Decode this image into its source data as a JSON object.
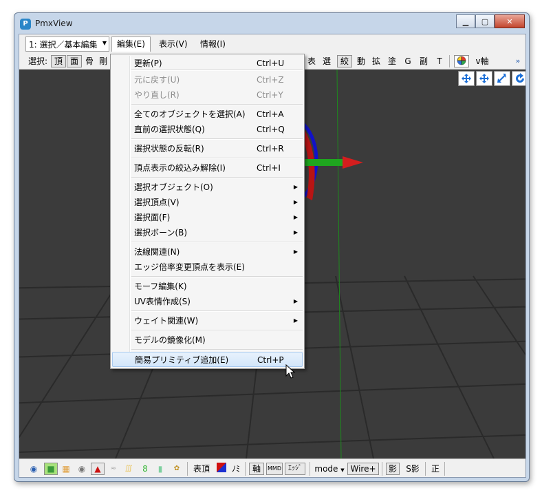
{
  "window": {
    "title": "PmxView",
    "icon": "pmxview-app-icon"
  },
  "menubar": {
    "mode_select": "1: 選択／基本編集",
    "items": [
      "編集(E)",
      "表示(V)",
      "情報(I)"
    ]
  },
  "toolbar": {
    "select_label": "選択:",
    "left_buttons": [
      "頂",
      "面",
      "骨",
      "剛"
    ],
    "right_buttons": [
      "表",
      "選",
      "絞",
      "動",
      "拡",
      "塗",
      "G",
      "副",
      "T"
    ],
    "axis_label": "v軸",
    "overflow": "»"
  },
  "edit_menu": [
    {
      "label": "更新(P)",
      "shortcut": "Ctrl+U"
    },
    {
      "label": "元に戻す(U)",
      "shortcut": "Ctrl+Z",
      "disabled": true
    },
    {
      "label": "やり直し(R)",
      "shortcut": "Ctrl+Y",
      "disabled": true
    },
    {
      "label": "全てのオブジェクトを選択(A)",
      "shortcut": "Ctrl+A"
    },
    {
      "label": "直前の選択状態(Q)",
      "shortcut": "Ctrl+Q"
    },
    {
      "label": "選択状態の反転(R)",
      "shortcut": "Ctrl+R"
    },
    {
      "label": "頂点表示の絞込み解除(I)",
      "shortcut": "Ctrl+I"
    },
    {
      "label": "選択オブジェクト(O)",
      "submenu": true
    },
    {
      "label": "選択頂点(V)",
      "submenu": true
    },
    {
      "label": "選択面(F)",
      "submenu": true
    },
    {
      "label": "選択ボーン(B)",
      "submenu": true
    },
    {
      "label": "法線関連(N)",
      "submenu": true
    },
    {
      "label": "エッジ倍率変更頂点を表示(E)"
    },
    {
      "label": "モーフ編集(K)"
    },
    {
      "label": "UV表情作成(S)",
      "submenu": true
    },
    {
      "label": "ウェイト関連(W)",
      "submenu": true
    },
    {
      "label": "モデルの鏡像化(M)"
    },
    {
      "label": "簡易プリミティブ追加(E)",
      "shortcut": "Ctrl+P",
      "highlighted": true
    }
  ],
  "statusbar": {
    "buttons": [
      "表頂",
      "ﾉﾐ",
      "軸",
      "MMD",
      "ｴｯｼﾞ",
      "mode",
      "Wire+",
      "影",
      "S影",
      "正"
    ]
  },
  "colors": {
    "viewport_bg": "#3b3b3b",
    "menu_highlight": "#d3e6fa",
    "grid": "#2a2a2a"
  }
}
